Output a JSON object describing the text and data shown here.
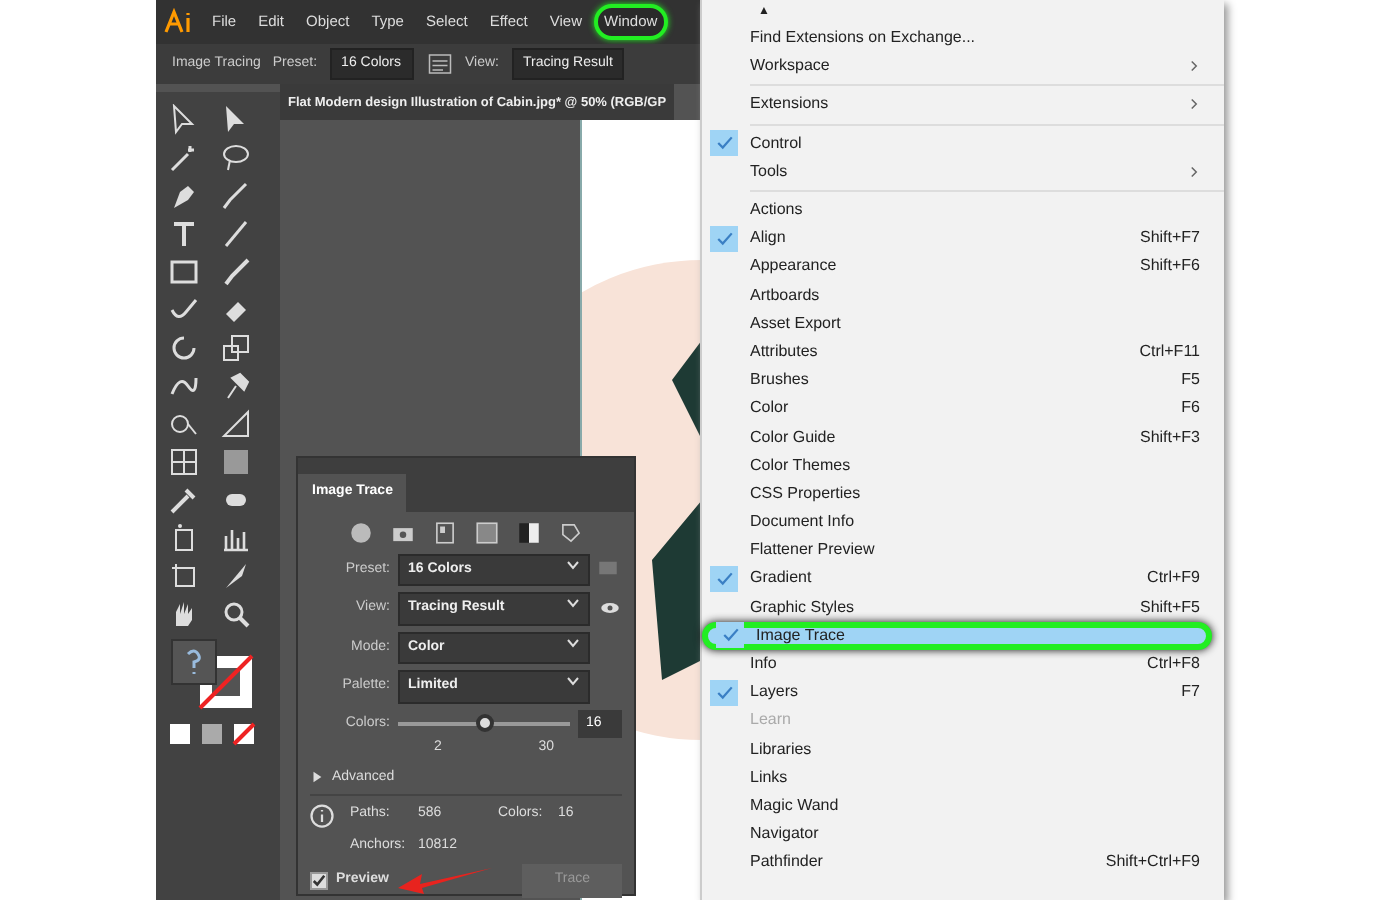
{
  "menu_bar": {
    "items": [
      {
        "label": "File",
        "selected": false
      },
      {
        "label": "Edit",
        "selected": false
      },
      {
        "label": "Object",
        "selected": false
      },
      {
        "label": "Type",
        "selected": false
      },
      {
        "label": "Select",
        "selected": false
      },
      {
        "label": "Effect",
        "selected": false
      },
      {
        "label": "View",
        "selected": false
      },
      {
        "label": "Window",
        "selected": true
      }
    ]
  },
  "control_bar": {
    "label": "Image Tracing",
    "preset_label": "Preset:",
    "preset_value": "16 Colors",
    "view_label": "View:",
    "view_value": "Tracing Result"
  },
  "document_tab": {
    "title": "Flat Modern design Illustration of Cabin.jpg* @ 50% (RGB/GP"
  },
  "image_trace_panel": {
    "title": "Image Trace",
    "fields": [
      {
        "label": "Preset:",
        "value": "16 Colors"
      },
      {
        "label": "View:",
        "value": "Tracing Result"
      },
      {
        "label": "Mode:",
        "value": "Color"
      },
      {
        "label": "Palette:",
        "value": "Limited"
      }
    ],
    "colors": {
      "label": "Colors:",
      "level": 0.5,
      "value": "16",
      "min": "2",
      "max": "30"
    },
    "advanced": {
      "label": "Advanced",
      "expanded": false
    },
    "stats": [
      {
        "label": "Paths:",
        "value": "586"
      },
      {
        "label": "Colors:",
        "value": "16"
      },
      {
        "label": "Anchors:",
        "value": "10812"
      }
    ],
    "preview": {
      "label": "Preview",
      "checked": true
    },
    "trace_button": {
      "label": "Trace",
      "disabled": true
    }
  },
  "window_menu": {
    "items": [
      {
        "kind": "scroll",
        "label": "▲"
      },
      {
        "kind": "item",
        "label": "Find Extensions on Exchange...",
        "checked": false
      },
      {
        "kind": "item",
        "label": "Workspace",
        "checked": false,
        "submenu": true
      },
      {
        "kind": "separator"
      },
      {
        "kind": "item",
        "label": "Extensions",
        "checked": false,
        "submenu": true
      },
      {
        "kind": "separator"
      },
      {
        "kind": "item",
        "label": "Control",
        "checked": true
      },
      {
        "kind": "item",
        "label": "Tools",
        "checked": false,
        "submenu": true
      },
      {
        "kind": "separator"
      },
      {
        "kind": "item",
        "label": "Actions",
        "checked": false
      },
      {
        "kind": "item",
        "label": "Align",
        "shortcut": "Shift+F7",
        "checked": true
      },
      {
        "kind": "item",
        "label": "Appearance",
        "shortcut": "Shift+F6",
        "checked": false
      },
      {
        "kind": "item",
        "label": "Artboards",
        "checked": false
      },
      {
        "kind": "item",
        "label": "Asset Export",
        "checked": false
      },
      {
        "kind": "item",
        "label": "Attributes",
        "shortcut": "Ctrl+F11",
        "checked": false
      },
      {
        "kind": "item",
        "label": "Brushes",
        "shortcut": "F5",
        "checked": false
      },
      {
        "kind": "item",
        "label": "Color",
        "shortcut": "F6",
        "checked": false
      },
      {
        "kind": "item",
        "label": "Color Guide",
        "shortcut": "Shift+F3",
        "checked": false
      },
      {
        "kind": "item",
        "label": "Color Themes",
        "checked": false
      },
      {
        "kind": "item",
        "label": "CSS Properties",
        "checked": false
      },
      {
        "kind": "item",
        "label": "Document Info",
        "checked": false
      },
      {
        "kind": "item",
        "label": "Flattener Preview",
        "checked": false
      },
      {
        "kind": "item",
        "label": "Gradient",
        "shortcut": "Ctrl+F9",
        "checked": true
      },
      {
        "kind": "item",
        "label": "Graphic Styles",
        "shortcut": "Shift+F5",
        "checked": false
      },
      {
        "kind": "item",
        "label": "Image Trace",
        "checked": true,
        "selected": true
      },
      {
        "kind": "item",
        "label": "Info",
        "shortcut": "Ctrl+F8",
        "checked": false
      },
      {
        "kind": "item",
        "label": "Layers",
        "shortcut": "F7",
        "checked": true
      },
      {
        "kind": "item",
        "label": "Learn",
        "checked": false,
        "disabled": true
      },
      {
        "kind": "item",
        "label": "Libraries",
        "checked": false
      },
      {
        "kind": "item",
        "label": "Links",
        "checked": false
      },
      {
        "kind": "item",
        "label": "Magic Wand",
        "checked": false
      },
      {
        "kind": "item",
        "label": "Navigator",
        "checked": false
      },
      {
        "kind": "item",
        "label": "Pathfinder",
        "shortcut": "Shift+Ctrl+F9",
        "checked": false
      }
    ]
  }
}
